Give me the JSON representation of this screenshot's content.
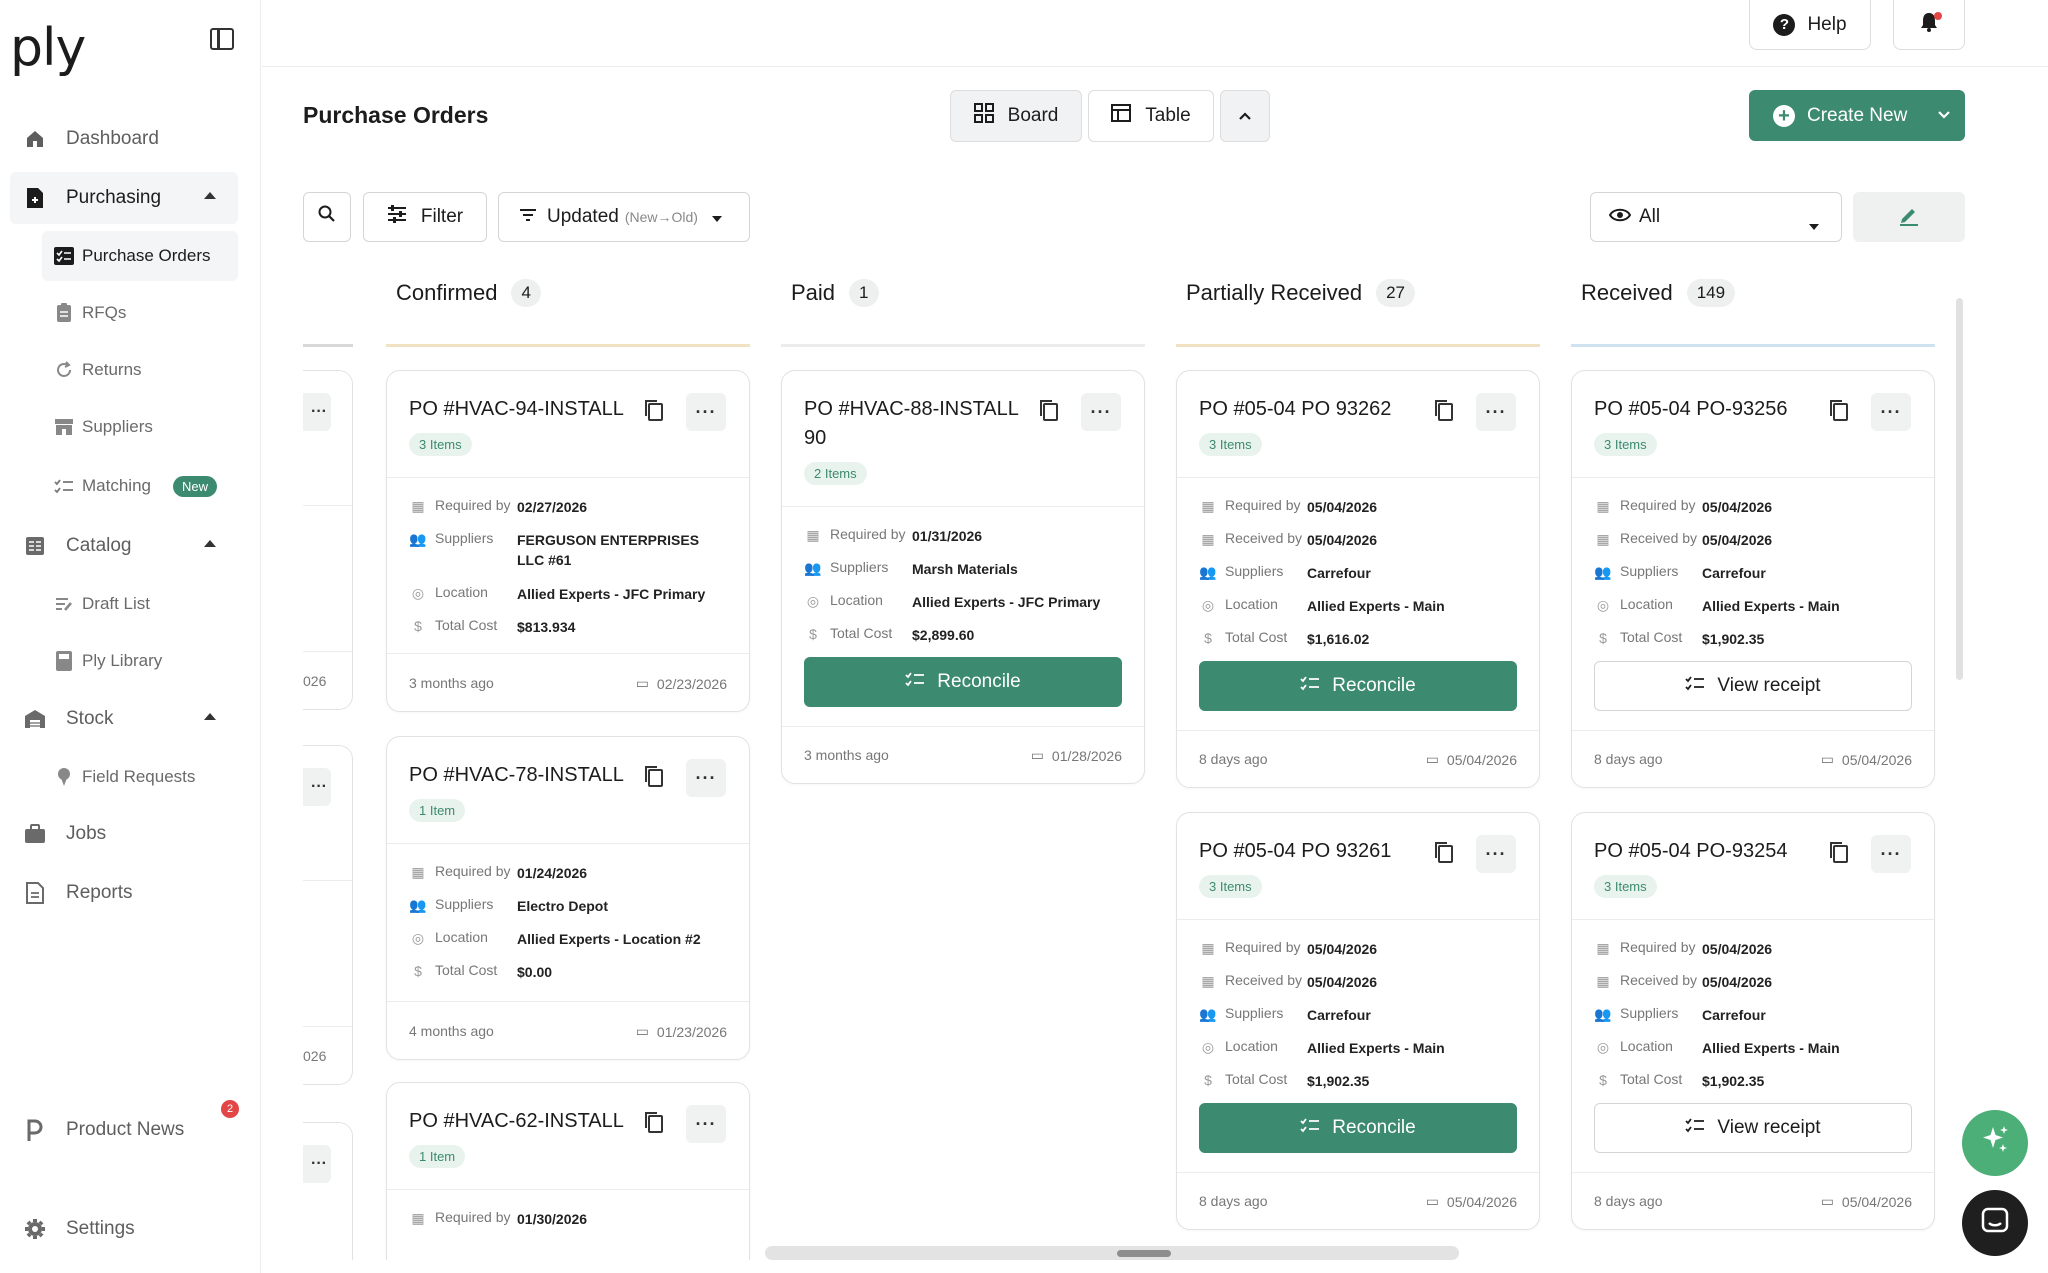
{
  "app": {
    "logo": "ply"
  },
  "sidebar": {
    "dashboard": "Dashboard",
    "purchasing": "Purchasing",
    "purchase_orders": "Purchase Orders",
    "rfqs": "RFQs",
    "returns": "Returns",
    "suppliers": "Suppliers",
    "matching": "Matching",
    "matching_badge": "New",
    "catalog": "Catalog",
    "draft_list": "Draft List",
    "ply_library": "Ply Library",
    "stock": "Stock",
    "field_requests": "Field Requests",
    "jobs": "Jobs",
    "reports": "Reports",
    "product_news": "Product News",
    "product_news_count": "2",
    "settings": "Settings"
  },
  "topbar": {
    "help": "Help"
  },
  "header": {
    "title": "Purchase Orders",
    "board": "Board",
    "table": "Table",
    "create_new": "Create New"
  },
  "toolbar": {
    "filter": "Filter",
    "sort": "Updated",
    "sort_hint": "(New→Old)",
    "visibility": "All"
  },
  "labels": {
    "required_by": "Required by",
    "received_by": "Received by",
    "suppliers": "Suppliers",
    "location": "Location",
    "total_cost": "Total Cost",
    "reconcile": "Reconcile",
    "view_receipt": "View receipt"
  },
  "partial_column": {
    "dates": [
      "026",
      "026"
    ]
  },
  "columns": [
    {
      "name": "Confirmed",
      "count": "4",
      "color": "#f2e2c4",
      "cards": [
        {
          "title": "PO #HVAC-94-INSTALL",
          "items": "3 Items",
          "required_by": "02/27/2026",
          "supplier": "FERGUSON ENTERPRISES LLC #61",
          "location": "Allied Experts - JFC Primary",
          "total": "$813.934",
          "ago": "3 months ago",
          "date": "02/23/2026"
        },
        {
          "title": "PO #HVAC-78-INSTALL",
          "items": "1 Item",
          "required_by": "01/24/2026",
          "supplier": "Electro Depot",
          "location": "Allied Experts - Location #2",
          "total": "$0.00",
          "ago": "4 months ago",
          "date": "01/23/2026"
        },
        {
          "title": "PO #HVAC-62-INSTALL",
          "items": "1 Item",
          "required_by": "01/30/2026"
        }
      ]
    },
    {
      "name": "Paid",
      "count": "1",
      "color": "#ececec",
      "cards": [
        {
          "title": "PO #HVAC-88-INSTALL 90",
          "items": "2 Items",
          "required_by": "01/31/2026",
          "supplier": "Marsh Materials",
          "location": "Allied Experts - JFC Primary",
          "total": "$2,899.60",
          "ago": "3 months ago",
          "date": "01/28/2026"
        }
      ]
    },
    {
      "name": "Partially Received",
      "count": "27",
      "color": "#f2e2c4",
      "cards": [
        {
          "title": "PO #05-04 PO 93262",
          "items": "3 Items",
          "required_by": "05/04/2026",
          "received_by": "05/04/2026",
          "supplier": "Carrefour",
          "location": "Allied Experts - Main",
          "total": "$1,616.02",
          "ago": "8 days ago",
          "date": "05/04/2026"
        },
        {
          "title": "PO #05-04 PO 93261",
          "items": "3 Items",
          "required_by": "05/04/2026",
          "received_by": "05/04/2026",
          "supplier": "Carrefour",
          "location": "Allied Experts - Main",
          "total": "$1,902.35",
          "ago": "8 days ago",
          "date": "05/04/2026"
        }
      ]
    },
    {
      "name": "Received",
      "count": "149",
      "color": "#cfe2f0",
      "cards": [
        {
          "title": "PO #05-04 PO-93256",
          "items": "3 Items",
          "required_by": "05/04/2026",
          "received_by": "05/04/2026",
          "supplier": "Carrefour",
          "location": "Allied Experts - Main",
          "total": "$1,902.35",
          "ago": "8 days ago",
          "date": "05/04/2026"
        },
        {
          "title": "PO #05-04 PO-93254",
          "items": "3 Items",
          "required_by": "05/04/2026",
          "received_by": "05/04/2026",
          "supplier": "Carrefour",
          "location": "Allied Experts - Main",
          "total": "$1,902.35",
          "ago": "8 days ago",
          "date": "05/04/2026"
        }
      ]
    }
  ],
  "colors": {
    "accent": "#3c8a70",
    "badge_red": "#e24646"
  }
}
